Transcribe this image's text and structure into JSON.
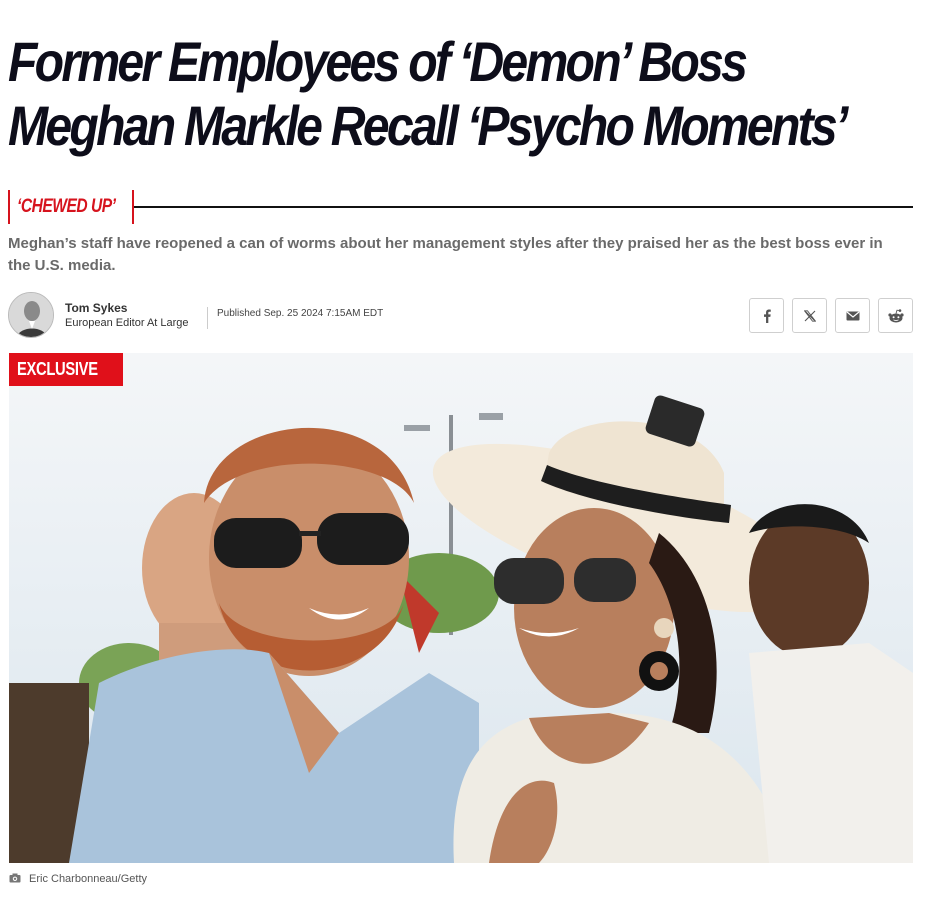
{
  "article": {
    "headline": "Former Employees of ‘Demon’ Boss Meghan Markle Recall ‘Psycho Moments’",
    "kicker": "‘CHEWED UP’",
    "dek": "Meghan’s staff have reopened a can of worms about her management styles after they praised her as the best boss ever in the U.S. media.",
    "badge": "EXCLUSIVE",
    "photo_credit": "Eric Charbonneau/Getty"
  },
  "author": {
    "name": "Tom Sykes",
    "title": "European Editor At Large",
    "published": "Published Sep. 25 2024 7:15AM EDT"
  },
  "share": {
    "buttons": [
      {
        "icon": "facebook-icon"
      },
      {
        "icon": "x-icon"
      },
      {
        "icon": "email-icon"
      },
      {
        "icon": "reddit-icon"
      }
    ]
  },
  "colors": {
    "accent": "#d6131d",
    "headline": "#0d0d1a",
    "dek": "#6a6a6a",
    "badge": "#e0101a"
  }
}
